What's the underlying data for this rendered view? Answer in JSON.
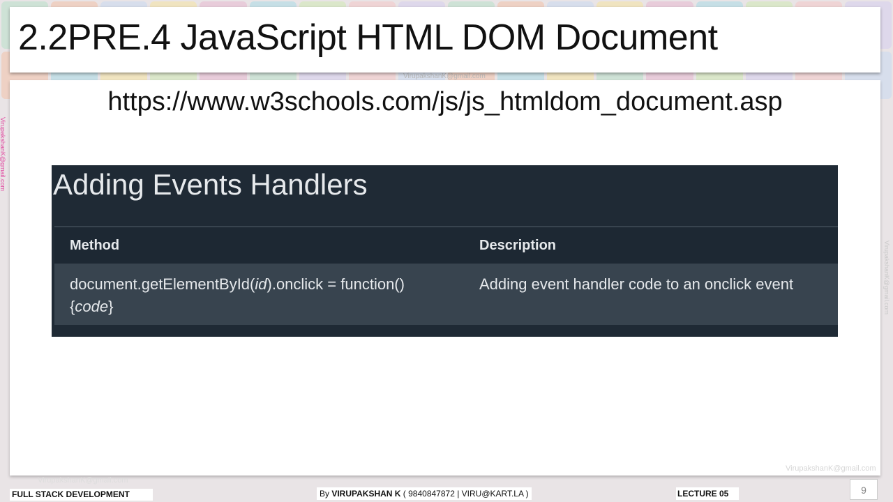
{
  "slide": {
    "title": "2.2PRE.4 JavaScript HTML DOM Document",
    "url": "https://www.w3schools.com/js/js_htmldom_document.asp",
    "watermark": "VirupakshanK@gmail.com"
  },
  "panel": {
    "heading": "Adding Events Handlers",
    "columns": [
      "Method",
      "Description"
    ],
    "row": {
      "method_line1_pre": "document.getElementById(",
      "method_line1_arg": "id",
      "method_line1_post": ").onclick = function()",
      "method_line2_open": "{",
      "method_line2_arg": "code",
      "method_line2_close": "}",
      "description": "Adding event handler code to an onclick event"
    }
  },
  "footer": {
    "course": "FULL STACK DEVELOPMENT",
    "by_prefix": "By ",
    "author": "VIRUPAKSHAN K",
    "contact": " ( 9840847872 | VIRU@KART.LA )",
    "lecture": "LECTURE 05",
    "page_number": "9",
    "email": "VirupakshanK@gmail.com"
  },
  "colors": {
    "panel_bg": "#1f2a35",
    "row_bg": "#38444f",
    "watermark_side": "#e04aa0"
  }
}
